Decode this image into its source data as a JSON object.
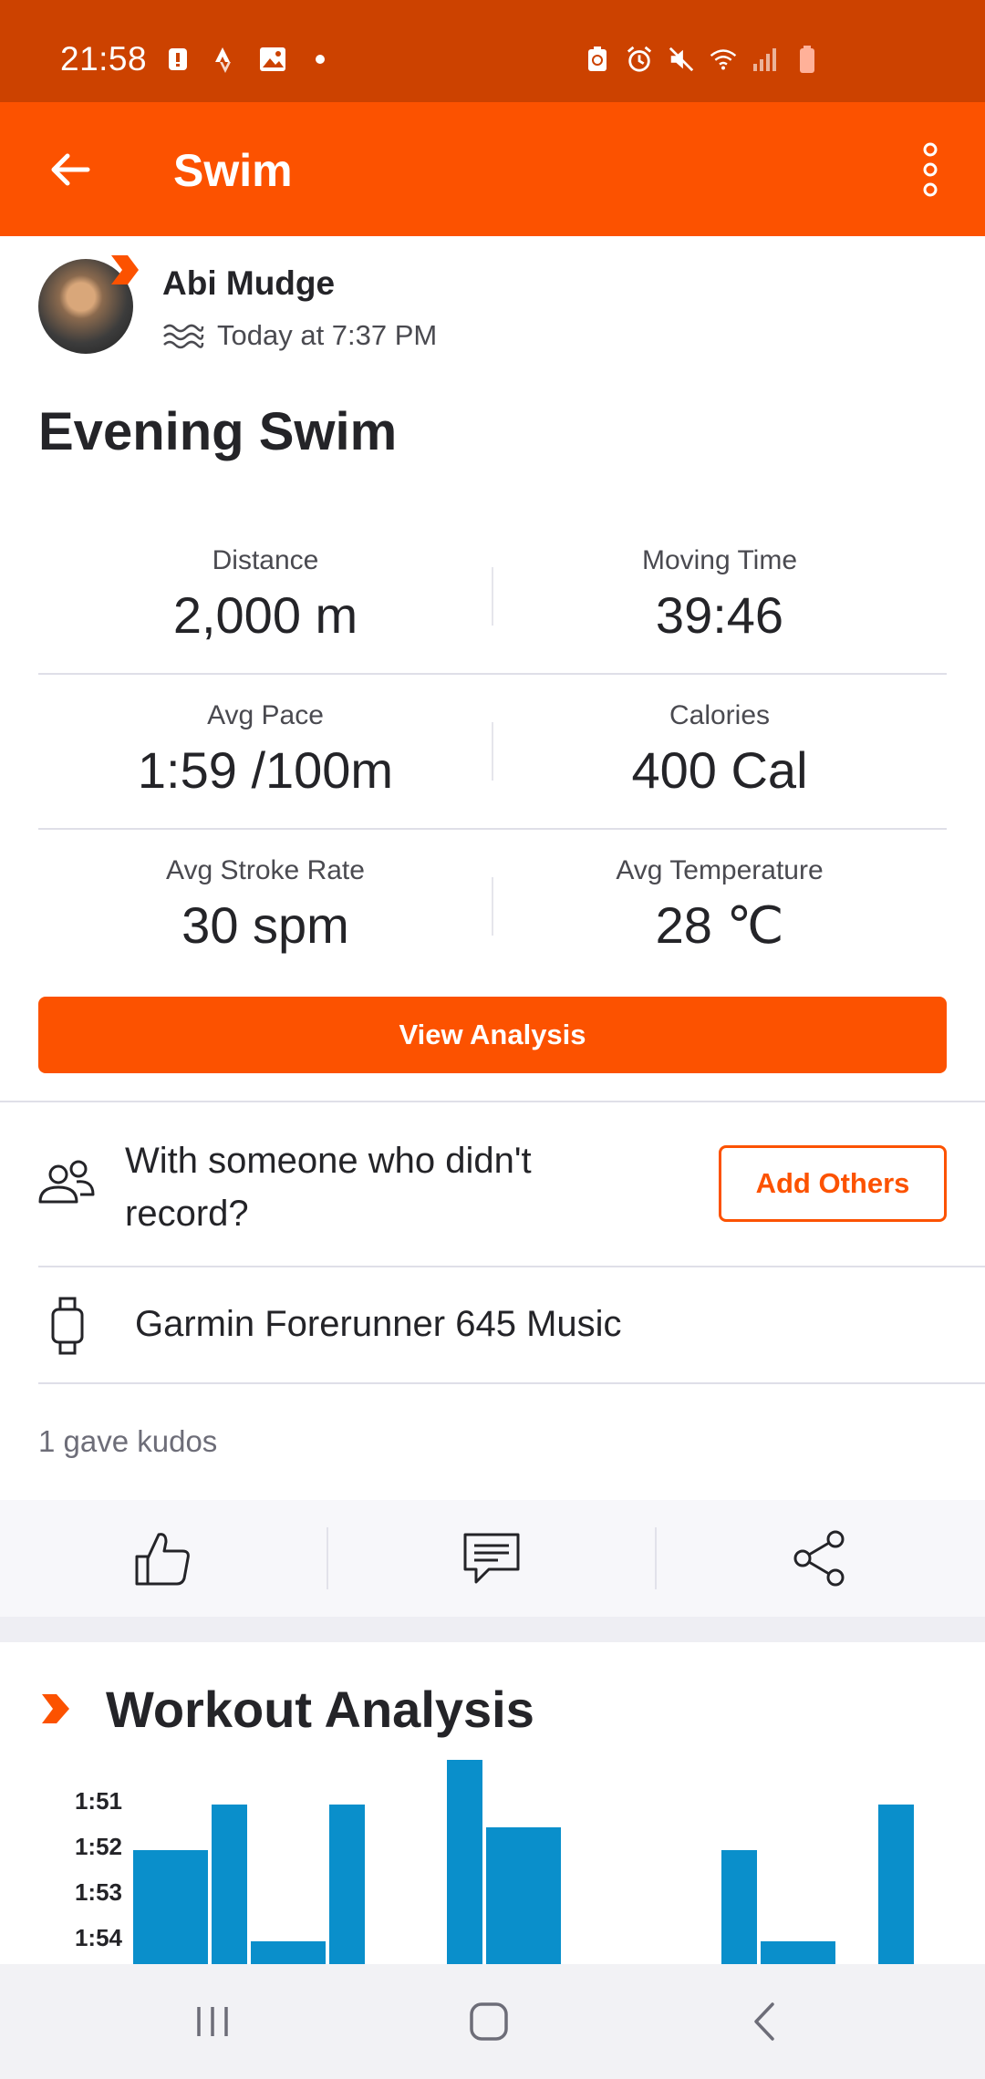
{
  "status_bar": {
    "time": "21:58",
    "left_icons": [
      "alert-icon",
      "strava-icon",
      "image-icon",
      "dot-icon"
    ],
    "right_icons": [
      "battery-saver-icon",
      "alarm-icon",
      "mute-icon",
      "wifi-icon",
      "signal-icon",
      "battery-icon"
    ]
  },
  "app_bar": {
    "title": "Swim"
  },
  "athlete": {
    "name": "Abi Mudge",
    "time": "Today at 7:37 PM",
    "sport_icon": "swim-icon"
  },
  "activity": {
    "title": "Evening Swim"
  },
  "stats": [
    [
      {
        "label": "Distance",
        "value": "2,000 m"
      },
      {
        "label": "Moving Time",
        "value": "39:46"
      }
    ],
    [
      {
        "label": "Avg Pace",
        "value": "1:59 /100m"
      },
      {
        "label": "Calories",
        "value": "400 Cal"
      }
    ],
    [
      {
        "label": "Avg Stroke Rate",
        "value": "30 spm"
      },
      {
        "label": "Avg Temperature",
        "value": "28 ℃"
      }
    ]
  ],
  "view_analysis": "View Analysis",
  "with_others": {
    "text": "With someone who didn't record?",
    "button": "Add Others"
  },
  "device": {
    "name": "Garmin Forerunner 645 Music"
  },
  "kudos": {
    "text": "1 gave kudos"
  },
  "actions": [
    "kudos-icon",
    "comment-icon",
    "share-icon"
  ],
  "workout_analysis": {
    "title": "Workout Analysis"
  },
  "colors": {
    "accent": "#fc5200",
    "status_bar": "#cc4200",
    "bar": "#0a8fcb"
  },
  "chart_data": {
    "type": "bar",
    "y_ticks": [
      "1:51",
      "1:52",
      "1:53",
      "1:54"
    ],
    "ylabel": "",
    "xlabel": "",
    "note": "Pace per lap (lower value = taller bar). Chart partially cut off at bottom.",
    "bars": [
      {
        "pace": "1:52",
        "seconds": 112,
        "width": 2
      },
      {
        "pace": "1:51",
        "seconds": 111,
        "width": 1
      },
      {
        "pace": "1:54",
        "seconds": 114,
        "width": 2
      },
      {
        "pace": "1:51",
        "seconds": 111,
        "width": 1
      },
      {
        "pace": null,
        "seconds": null,
        "width": 2
      },
      {
        "pace": "1:50",
        "seconds": 110,
        "width": 1
      },
      {
        "pace": "1:51.5",
        "seconds": 111.5,
        "width": 2
      },
      {
        "pace": null,
        "seconds": null,
        "width": 2
      },
      {
        "pace": null,
        "seconds": null,
        "width": 2
      },
      {
        "pace": "1:52",
        "seconds": 112,
        "width": 1
      },
      {
        "pace": "1:54",
        "seconds": 114,
        "width": 2
      },
      {
        "pace": null,
        "seconds": null,
        "width": 1
      },
      {
        "pace": "1:51",
        "seconds": 111,
        "width": 1
      }
    ]
  },
  "nav_bar": [
    "recents-icon",
    "home-icon",
    "back-nav-icon"
  ]
}
